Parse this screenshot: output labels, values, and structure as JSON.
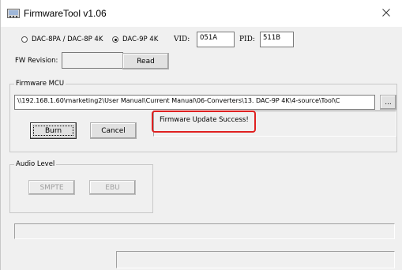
{
  "window": {
    "title": "FirmwareTool v1.06",
    "close_glyph": "✕",
    "app_icon": "firmware-app-icon",
    "close_icon": "close-icon"
  },
  "model": {
    "options": [
      "DAC-8PA / DAC-8P 4K",
      "DAC-9P 4K"
    ],
    "selected": "DAC-9P 4K"
  },
  "vid": {
    "label": "VID:",
    "value": "051A"
  },
  "pid": {
    "label": "PID:",
    "value": "511B"
  },
  "fw_revision": {
    "label": "FW Revision:",
    "value": "",
    "read_label": "Read"
  },
  "firmware_mcu": {
    "group_title": "Firmware MCU",
    "path": "\\\\192.168.1.60\\marketing2\\User Manual\\Current Manual\\06-Converters\\13. DAC-9P 4K\\4-source\\Tool\\C",
    "browse_label": "...",
    "burn_label": "Burn",
    "cancel_label": "Cancel",
    "status": "Firmware Update Success!"
  },
  "audio_level": {
    "group_title": "Audio Level",
    "smpte_label": "SMPTE",
    "ebu_label": "EBU"
  },
  "colors": {
    "highlight": "#e02020",
    "window_bg": "#f0f0f0"
  }
}
